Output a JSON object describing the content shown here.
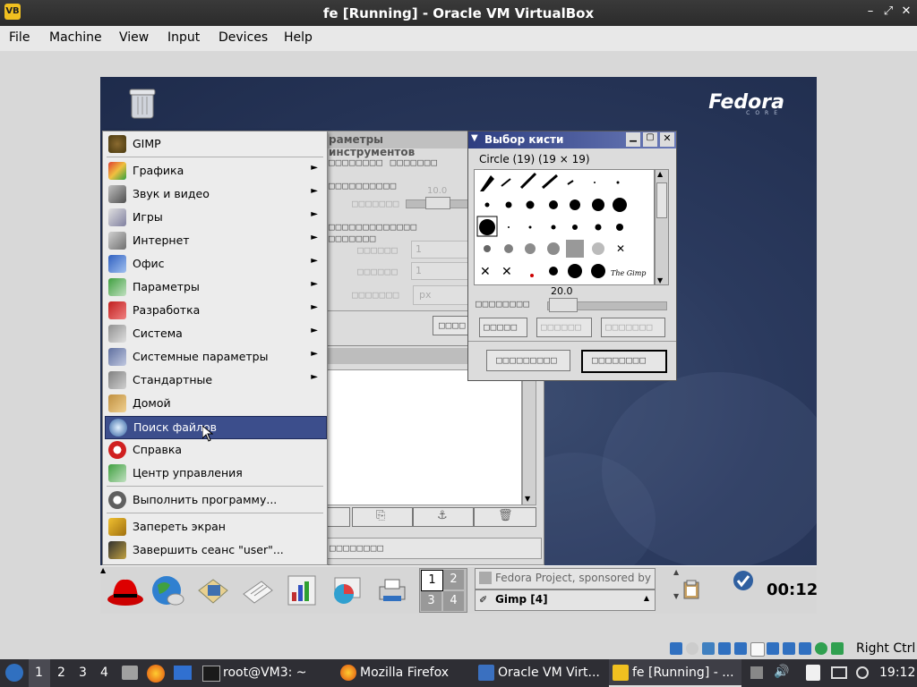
{
  "window": {
    "title": "fe [Running] - Oracle VM VirtualBox",
    "app_icon": "virtualbox-icon"
  },
  "menubar": [
    "File",
    "Machine",
    "View",
    "Input",
    "Devices",
    "Help"
  ],
  "guest": {
    "fedora_logo": "Fedora",
    "fedora_sub": "CORE",
    "bg_window_title": "раметры инструментов",
    "slider_value": "10.0",
    "start_menu": {
      "items": [
        {
          "label": "GIMP",
          "icon": "gimp-icon",
          "submenu": false
        },
        {
          "label": "Графика",
          "icon": "graphics-icon",
          "submenu": true
        },
        {
          "label": "Звук и видео",
          "icon": "multimedia-icon",
          "submenu": true
        },
        {
          "label": "Игры",
          "icon": "games-icon",
          "submenu": true
        },
        {
          "label": "Интернет",
          "icon": "internet-icon",
          "submenu": true
        },
        {
          "label": "Офис",
          "icon": "office-icon",
          "submenu": true
        },
        {
          "label": "Параметры",
          "icon": "preferences-icon",
          "submenu": true
        },
        {
          "label": "Разработка",
          "icon": "development-icon",
          "submenu": true
        },
        {
          "label": "Система",
          "icon": "system-icon",
          "submenu": true
        },
        {
          "label": "Системные параметры",
          "icon": "system-settings-icon",
          "submenu": true
        },
        {
          "label": "Стандартные",
          "icon": "accessories-icon",
          "submenu": true
        },
        {
          "label": "Домой",
          "icon": "home-folder-icon",
          "submenu": false
        },
        {
          "label": "Поиск файлов",
          "icon": "search-icon",
          "submenu": false,
          "highlighted": true
        },
        {
          "label": "Справка",
          "icon": "help-icon",
          "submenu": false
        },
        {
          "label": "Центр управления",
          "icon": "control-center-icon",
          "submenu": false
        },
        {
          "label": "Выполнить программу...",
          "icon": "run-icon",
          "submenu": false
        },
        {
          "label": "Запереть экран",
          "icon": "lock-icon",
          "submenu": false
        },
        {
          "label": "Завершить сеанс \"user\"...",
          "icon": "logout-icon",
          "submenu": false
        }
      ]
    },
    "brush_dialog": {
      "title": "Выбор кисти",
      "brush_info": "Circle (19)  (19 × 19)",
      "spacing_value": "20.0"
    },
    "panel": {
      "workspaces": [
        "1",
        "2",
        "3",
        "4"
      ],
      "active_workspace": "1",
      "task_top": "Fedora Project, sponsored by",
      "task_bottom": "Gimp [4]",
      "clock": "00:12"
    }
  },
  "host_status": {
    "right_ctrl": "Right Ctrl"
  },
  "taskbar": {
    "workspaces": [
      "1",
      "2",
      "3",
      "4"
    ],
    "active_workspace": "1",
    "tasks": [
      {
        "label": "root@VM3: ~",
        "icon": "terminal-icon"
      },
      {
        "label": "Mozilla Firefox",
        "icon": "firefox-icon"
      },
      {
        "label": "Oracle VM Virt...",
        "icon": "virtualbox-icon"
      },
      {
        "label": "fe [Running] - ...",
        "icon": "virtualbox-icon",
        "active": true
      }
    ],
    "time": "19:12"
  }
}
